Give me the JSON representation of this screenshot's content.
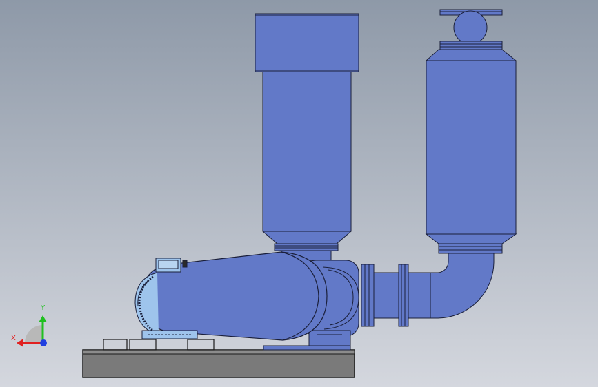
{
  "view": {
    "background_top": "#8e99a8",
    "background_bottom": "#d4d7de",
    "part_color": "#6279c8",
    "part_edge": "#1a1f3a",
    "motor_color": "#9ec4ec",
    "base_color": "#7a7a7a"
  },
  "triad": {
    "x_label": "X",
    "y_label": "Y",
    "x_color": "#e02020",
    "y_color": "#20c020",
    "z_color": "#2040e0"
  }
}
